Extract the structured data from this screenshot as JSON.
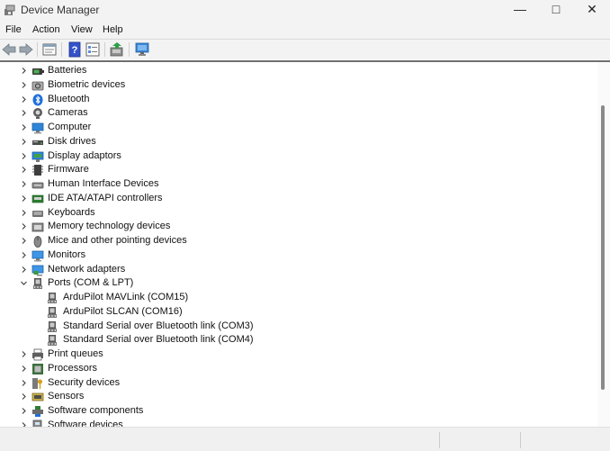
{
  "window": {
    "title": "Device Manager",
    "minimize": "—",
    "maximize": "□",
    "close": "✕"
  },
  "menu": [
    {
      "key": "file",
      "label": "File"
    },
    {
      "key": "action",
      "label": "Action"
    },
    {
      "key": "view",
      "label": "View"
    },
    {
      "key": "help",
      "label": "Help"
    }
  ],
  "tree": [
    {
      "name": "batteries",
      "label": "Batteries",
      "icon": "battery-icon",
      "expanded": false
    },
    {
      "name": "biometric-devices",
      "label": "Biometric devices",
      "icon": "biometric-icon",
      "expanded": false
    },
    {
      "name": "bluetooth",
      "label": "Bluetooth",
      "icon": "bluetooth-icon",
      "expanded": false
    },
    {
      "name": "cameras",
      "label": "Cameras",
      "icon": "camera-icon",
      "expanded": false
    },
    {
      "name": "computer",
      "label": "Computer",
      "icon": "computer-icon",
      "expanded": false
    },
    {
      "name": "disk-drives",
      "label": "Disk drives",
      "icon": "disk-drive-icon",
      "expanded": false
    },
    {
      "name": "display-adaptors",
      "label": "Display adaptors",
      "icon": "display-adapter-icon",
      "expanded": false
    },
    {
      "name": "firmware",
      "label": "Firmware",
      "icon": "firmware-icon",
      "expanded": false
    },
    {
      "name": "human-interface-devices",
      "label": "Human Interface Devices",
      "icon": "hid-icon",
      "expanded": false
    },
    {
      "name": "ide-ata-atapi-controllers",
      "label": "IDE ATA/ATAPI controllers",
      "icon": "ide-controller-icon",
      "expanded": false
    },
    {
      "name": "keyboards",
      "label": "Keyboards",
      "icon": "keyboard-icon",
      "expanded": false
    },
    {
      "name": "memory-technology-devices",
      "label": "Memory technology devices",
      "icon": "memory-icon",
      "expanded": false
    },
    {
      "name": "mice-and-other-pointing-devices",
      "label": "Mice and other pointing devices",
      "icon": "mouse-icon",
      "expanded": false
    },
    {
      "name": "monitors",
      "label": "Monitors",
      "icon": "monitor-icon",
      "expanded": false
    },
    {
      "name": "network-adapters",
      "label": "Network adapters",
      "icon": "network-adapter-icon",
      "expanded": false
    },
    {
      "name": "ports",
      "label": "Ports (COM & LPT)",
      "icon": "port-icon",
      "expanded": true,
      "children": [
        {
          "name": "ardupilot-mavlink",
          "label": "ArduPilot MAVLink (COM15)",
          "icon": "port-icon"
        },
        {
          "name": "ardupilot-slcan",
          "label": "ArduPilot SLCAN (COM16)",
          "icon": "port-icon"
        },
        {
          "name": "bt-serial-com3",
          "label": "Standard Serial over Bluetooth link (COM3)",
          "icon": "port-icon"
        },
        {
          "name": "bt-serial-com4",
          "label": "Standard Serial over Bluetooth link (COM4)",
          "icon": "port-icon"
        }
      ]
    },
    {
      "name": "print-queues",
      "label": "Print queues",
      "icon": "printer-icon",
      "expanded": false
    },
    {
      "name": "processors",
      "label": "Processors",
      "icon": "processor-icon",
      "expanded": false
    },
    {
      "name": "security-devices",
      "label": "Security devices",
      "icon": "security-icon",
      "expanded": false
    },
    {
      "name": "sensors",
      "label": "Sensors",
      "icon": "sensor-icon",
      "expanded": false
    },
    {
      "name": "software-components",
      "label": "Software components",
      "icon": "software-component-icon",
      "expanded": false
    },
    {
      "name": "software-devices",
      "label": "Software devices",
      "icon": "software-device-icon",
      "expanded": false
    }
  ]
}
